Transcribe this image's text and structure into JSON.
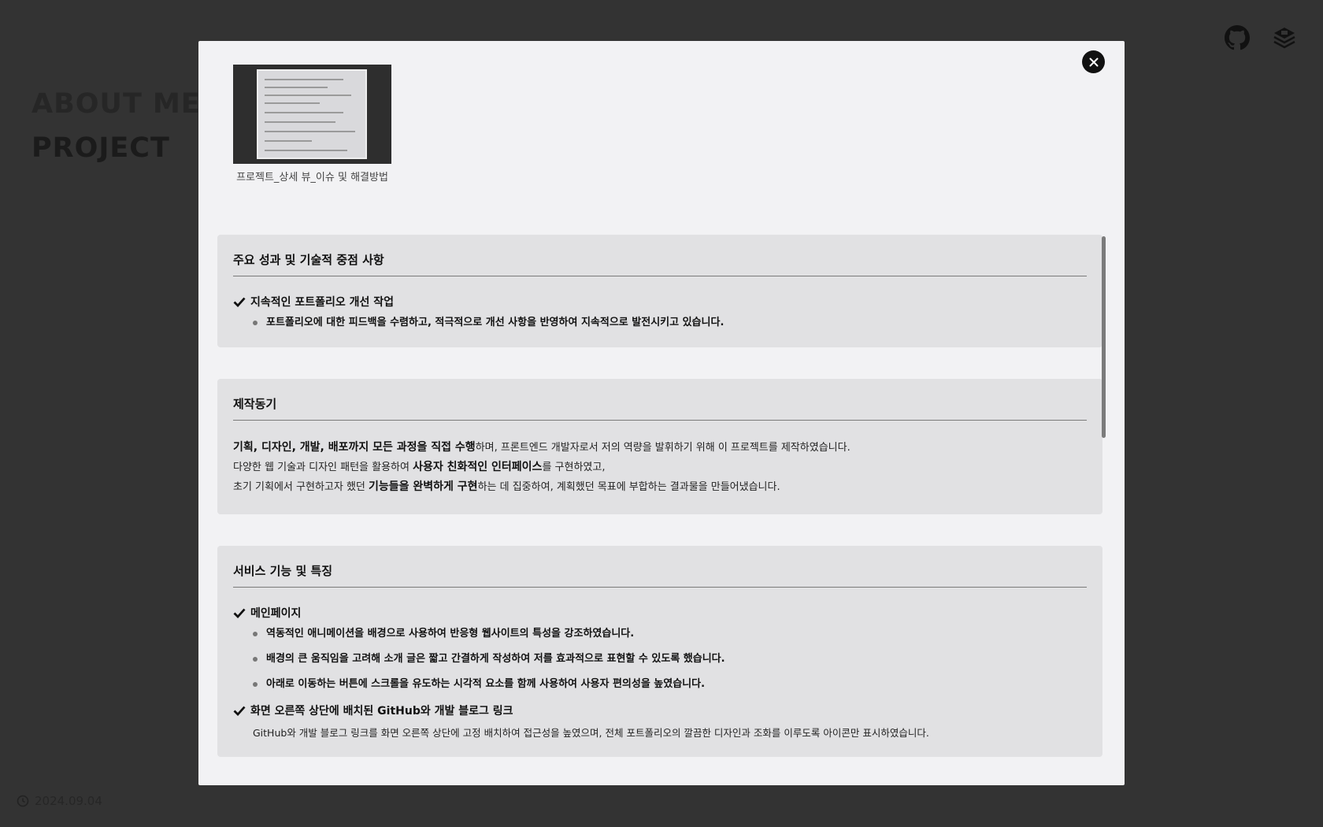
{
  "background": {
    "nav": [
      "ABOUT ME",
      "PROJECT"
    ],
    "date": "2024.09.04",
    "icons": [
      "github-icon",
      "blog-icon"
    ]
  },
  "modal": {
    "thumbnail_caption": "프로젝트_상세 뷰_이슈 및 해결방법",
    "sections": {
      "achievements": {
        "title": "주요 성과 및 기술적 중점 사항",
        "item_title": "지속적인 포트폴리오 개선 작업",
        "item_bullet": "포트폴리오에 대한 피드백을 수렴하고, 적극적으로 개선 사항을 반영하여 지속적으로 발전시키고 있습니다."
      },
      "motivation": {
        "title": "제작동기",
        "line1_bold": "기획, 디자인, 개발, 배포까지 모든 과정을 직접 수행",
        "line1_rest": "하며, 프론트엔드 개발자로서 저의 역량을 발휘하기 위해 이 프로젝트를 제작하였습니다.",
        "line2_pre": "다양한 웹 기술과 디자인 패턴을 활용하여 ",
        "line2_bold": "사용자 친화적인 인터페이스",
        "line2_rest": "를 구현하였고,",
        "line3_pre": "초기 기획에서 구현하고자 했던 ",
        "line3_bold": "기능들을 완벽하게 구현",
        "line3_rest": "하는 데 집중하여, 계획했던 목표에 부합하는 결과물을 만들어냈습니다."
      },
      "features": {
        "title": "서비스 기능 및 특징",
        "item1_title": "메인페이지",
        "item1_bullets": [
          "역동적인 애니메이션을 배경으로 사용하여 반응형 웹사이트의 특성을 강조하였습니다.",
          "배경의 큰 움직임을 고려해 소개 글은 짧고 간결하게 작성하여 저를 효과적으로 표현할 수 있도록 했습니다.",
          "아래로 이동하는 버튼에 스크롤을 유도하는 시각적 요소를 함께 사용하여 사용자 편의성을 높였습니다."
        ],
        "item2_title": "화면 오른쪽 상단에 배치된 GitHub와 개발 블로그 링크",
        "item2_text": "GitHub와 개발 블로그 링크를 화면 오른쪽 상단에 고정 배치하여 접근성을 높였으며, 전체 포트폴리오의 깔끔한 디자인과 조화를 이루도록 아이콘만 표시하였습니다."
      }
    }
  }
}
